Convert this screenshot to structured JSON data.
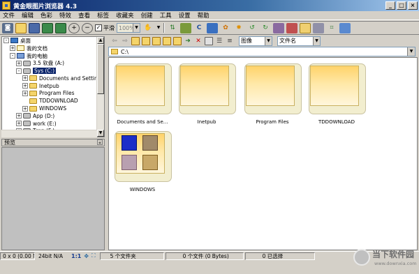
{
  "window": {
    "title": "黄金眼图片浏览器  4.3",
    "min": "_",
    "max": "□",
    "close": "×"
  },
  "menu": [
    "文件",
    "编辑",
    "色彩",
    "特效",
    "查看",
    "标签",
    "收藏夹",
    "创建",
    "工具",
    "设置",
    "帮助"
  ],
  "toolbar": {
    "smooth_label": "平滑",
    "zoom_value": "100%",
    "view_mode": "图像",
    "sort_by": "文件名"
  },
  "path": "C:\\",
  "tree": [
    {
      "label": "桌面",
      "level": 0,
      "icon": "desktop-icon",
      "expander": "-"
    },
    {
      "label": "我的文档",
      "level": 1,
      "icon": "documents-icon",
      "expander": "+"
    },
    {
      "label": "我的电脑",
      "level": 1,
      "icon": "computer-icon",
      "expander": "-"
    },
    {
      "label": "3.5 软盘 (A:)",
      "level": 2,
      "icon": "floppy-icon",
      "expander": "+"
    },
    {
      "label": "Sys (C:)",
      "level": 2,
      "icon": "drive-icon",
      "expander": "-",
      "selected": true
    },
    {
      "label": "Documents and Setting",
      "level": 3,
      "icon": "folder-icon",
      "expander": "+"
    },
    {
      "label": "Inetpub",
      "level": 3,
      "icon": "folder-icon",
      "expander": "+"
    },
    {
      "label": "Program Files",
      "level": 3,
      "icon": "folder-icon",
      "expander": "+"
    },
    {
      "label": "TDDOWNLOAD",
      "level": 3,
      "icon": "folder-icon",
      "expander": ""
    },
    {
      "label": "WINDOWS",
      "level": 3,
      "icon": "folder-icon",
      "expander": "+"
    },
    {
      "label": "App (D:)",
      "level": 2,
      "icon": "drive-icon",
      "expander": "+"
    },
    {
      "label": "work (E:)",
      "level": 2,
      "icon": "drive-icon",
      "expander": "+"
    },
    {
      "label": "Tmp (F:)",
      "level": 2,
      "icon": "drive-icon",
      "expander": "+"
    }
  ],
  "preview": {
    "title": "预览",
    "pin": "«"
  },
  "folders": [
    {
      "name": "Documents and Se..."
    },
    {
      "name": "Inetpub"
    },
    {
      "name": "Program Files"
    },
    {
      "name": "TDDOWNLOAD"
    },
    {
      "name": "WINDOWS"
    }
  ],
  "status": {
    "image_info": "0 x 0 (0.00 MP)",
    "bit_info": "24bit N/A",
    "ratio": "1:1",
    "folders_count": "5 个文件夹",
    "files_count": "0 个文件 (0 Bytes)",
    "selected": "0 已选择"
  },
  "watermark": {
    "text": "当下软件园",
    "url": "www.downxia.com"
  }
}
